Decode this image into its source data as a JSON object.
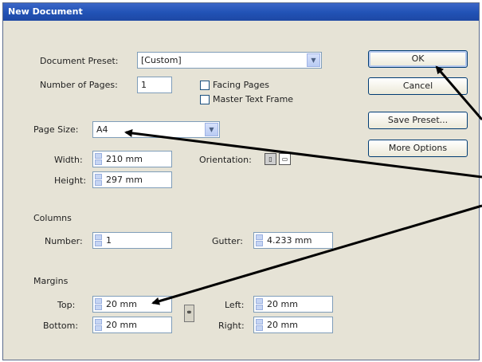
{
  "dialog": {
    "title": "New Document"
  },
  "preset": {
    "label": "Document Preset:",
    "value": "[Custom]"
  },
  "pages": {
    "label": "Number of Pages:",
    "value": "1"
  },
  "facing_pages": {
    "label": "Facing Pages",
    "checked": false
  },
  "master_text_frame": {
    "label": "Master Text Frame",
    "checked": false
  },
  "page_size": {
    "label": "Page Size:",
    "value": "A4"
  },
  "width": {
    "label": "Width:",
    "value": "210 mm"
  },
  "height": {
    "label": "Height:",
    "value": "297 mm"
  },
  "orientation": {
    "label": "Orientation:",
    "selected": "portrait"
  },
  "columns": {
    "section_label": "Columns",
    "number_label": "Number:",
    "number_value": "1",
    "gutter_label": "Gutter:",
    "gutter_value": "4.233 mm"
  },
  "margins": {
    "section_label": "Margins",
    "top_label": "Top:",
    "top_value": "20 mm",
    "bottom_label": "Bottom:",
    "bottom_value": "20 mm",
    "left_label": "Left:",
    "left_value": "20 mm",
    "right_label": "Right:",
    "right_value": "20 mm"
  },
  "buttons": {
    "ok": "OK",
    "cancel": "Cancel",
    "save_preset": "Save Preset...",
    "more_options": "More Options"
  },
  "colors": {
    "titlebar": "#2152b5",
    "dialog_bg": "#e6e3d6",
    "annotation_arrow": "#000000"
  },
  "icons": {
    "dropdown": "chevron-down-icon",
    "spin": "spin-arrows-icon",
    "link": "chain-link-icon",
    "portrait": "portrait-icon",
    "landscape": "landscape-icon"
  }
}
